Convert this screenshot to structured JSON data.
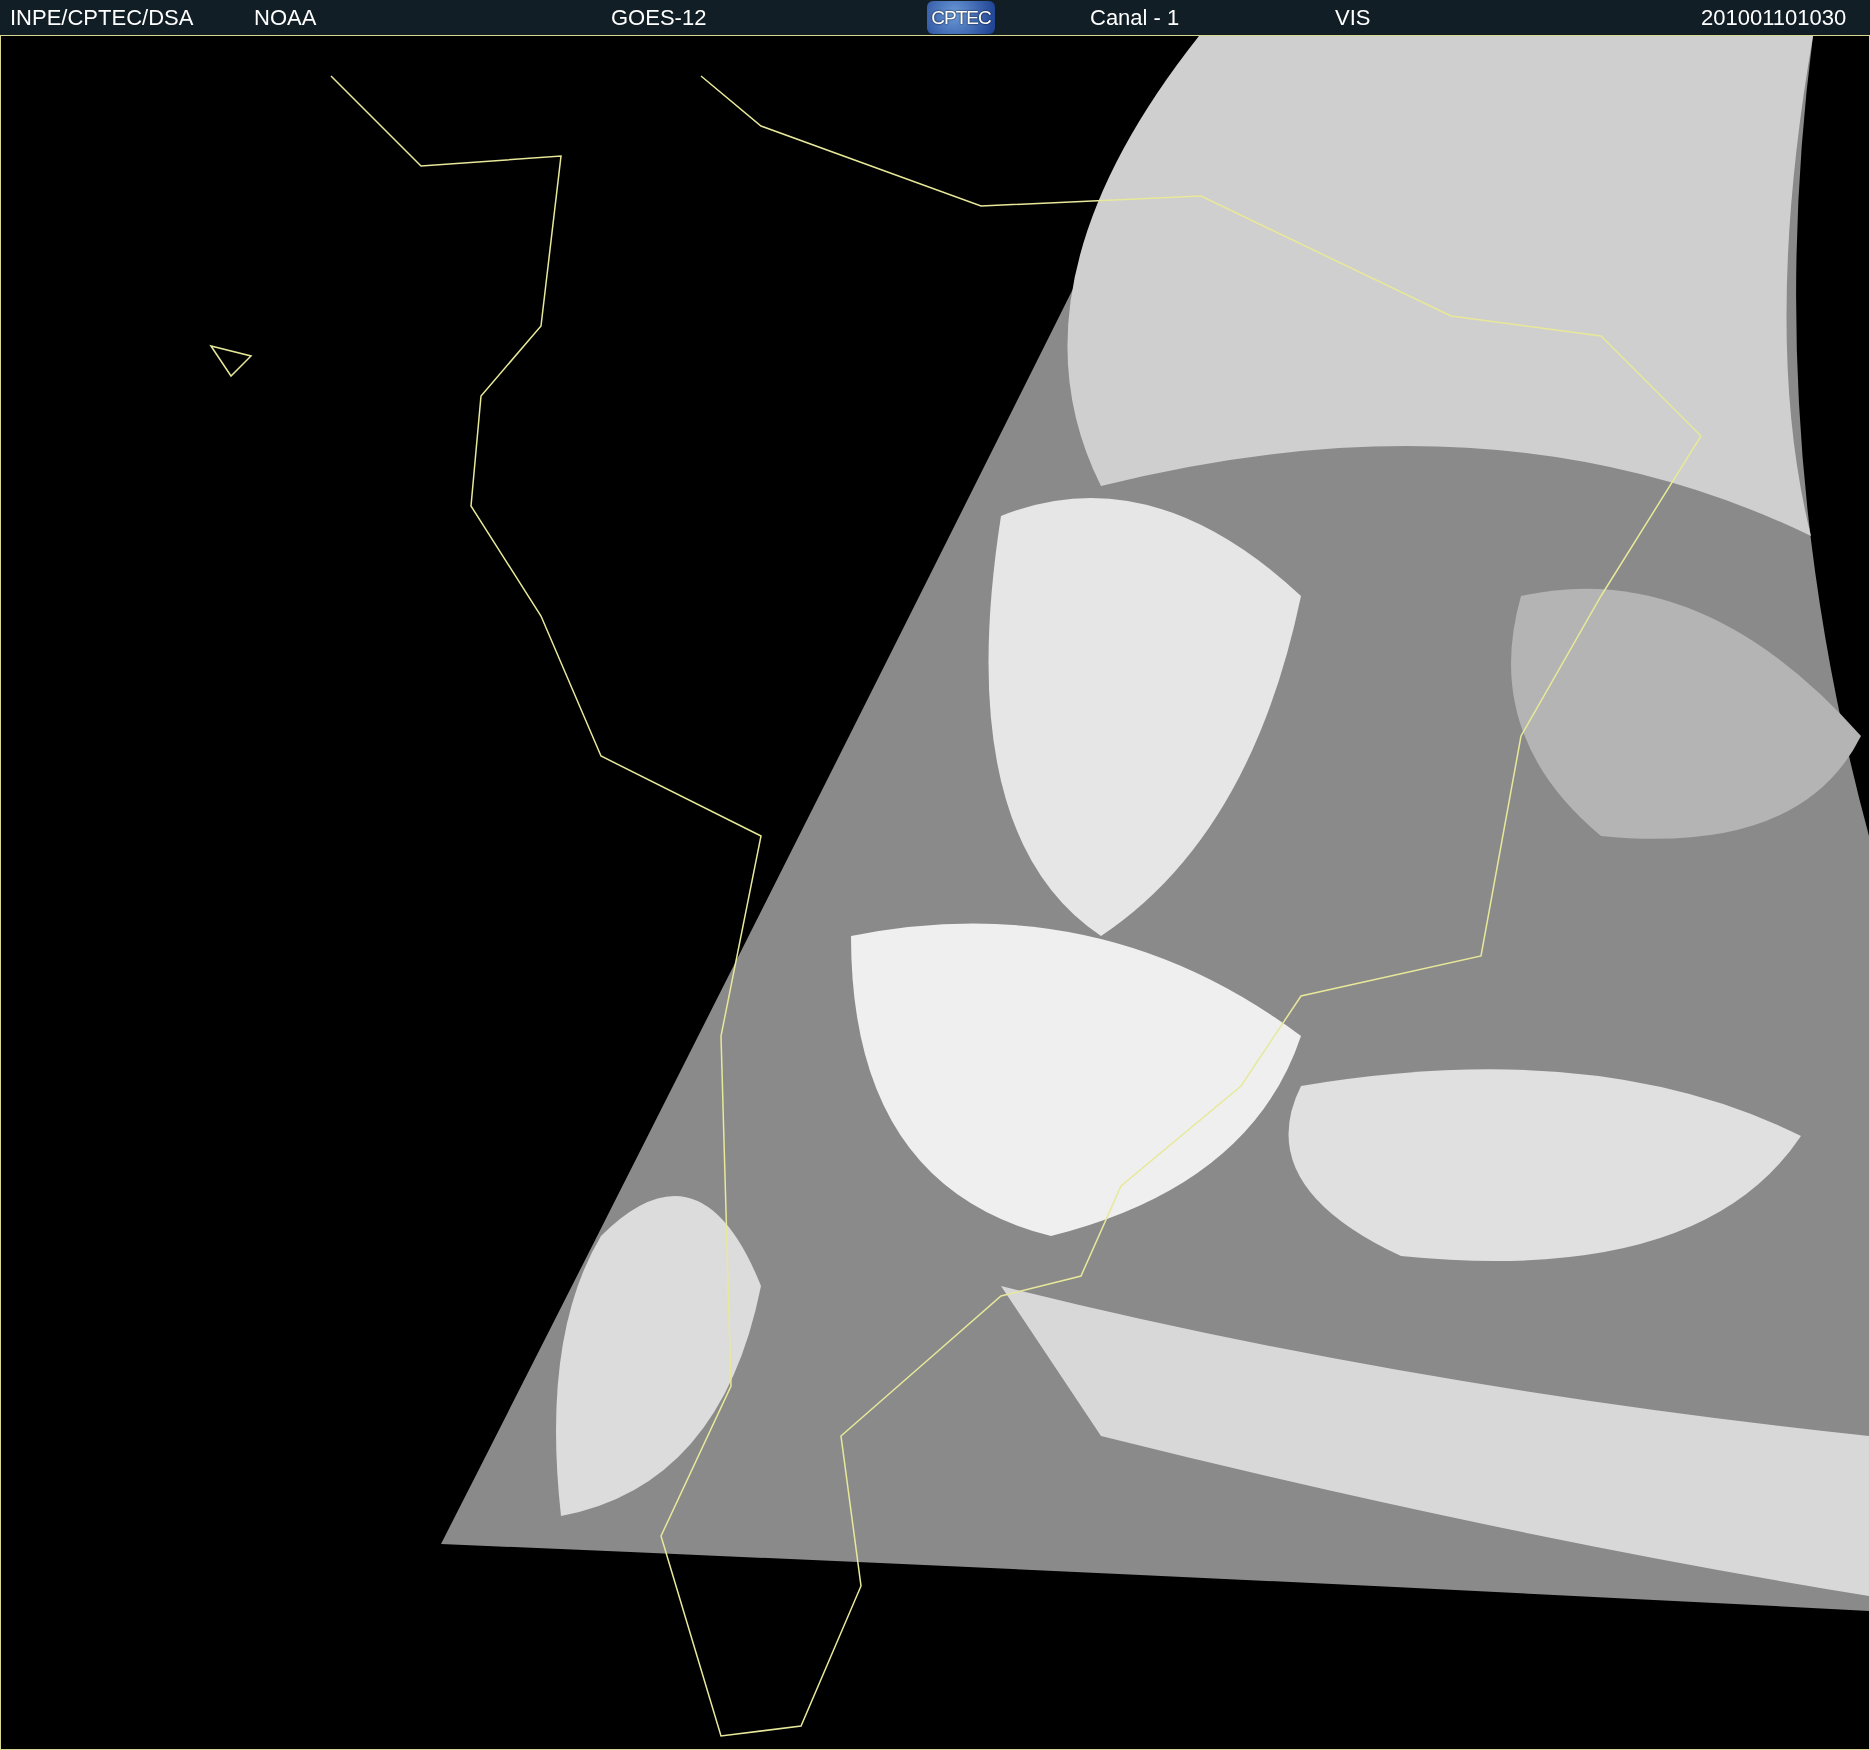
{
  "header": {
    "source": "INPE/CPTEC/DSA",
    "agency": "NOAA",
    "satellite": "GOES-12",
    "logo": "CPTEC",
    "channel": "Canal - 1",
    "band": "VIS",
    "timestamp": "201001101030"
  }
}
